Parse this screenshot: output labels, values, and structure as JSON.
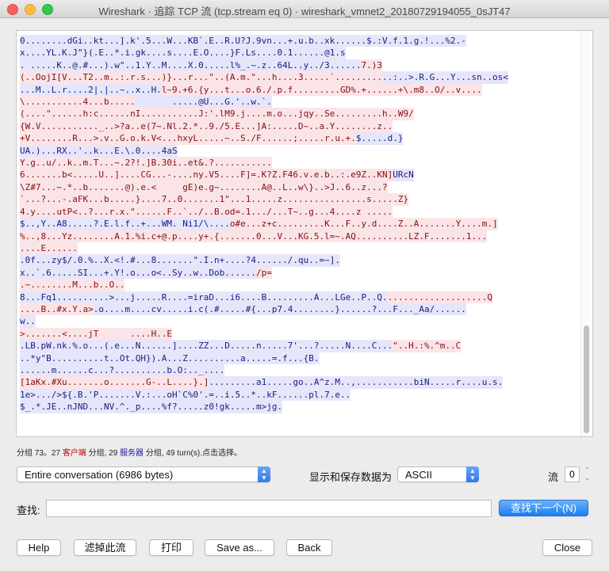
{
  "window": {
    "title": "Wireshark · 追踪 TCP 流 (tcp.stream eq 0) · wireshark_vmnet2_20180729194055_0sJT47"
  },
  "stream_lines": [
    [
      {
        "t": "0........dGi..kt...].k'.5...W...KB`.E..R.U?J.9vn...+.u.b..xk......$.:V.f.1.g.!...%2.-",
        "c": "srv"
      }
    ],
    [
      {
        "t": "x....YL.K.J\"}(.E..*.i.gk....s....E.O....}F.Ls....0.1......@1.s",
        "c": "srv"
      }
    ],
    [
      {
        "t": ". .....K..@.#...).w\"..1.Y..M....X.0.....l%_.~.z..64L..y../3......",
        "c": "srv"
      },
      {
        "t": "7.)3",
        "c": "cli"
      }
    ],
    [
      {
        "t": "(..OojI[V...T2..m..:.r.s...)}...r...\"..(A.m.\"...h....3.....`.........",
        "c": "cli"
      },
      {
        "t": "..:..>.R.G...Y...sn..os<",
        "c": "srv"
      }
    ],
    [
      {
        "t": "...M..L.r....2|.|..~..x..H.",
        "c": "srv"
      },
      {
        "t": "l~9.+6.{y...t...o.6./.p.f.........GD%.+......+\\.m8..O/..v....",
        "c": "cli"
      }
    ],
    [
      {
        "t": "\\...........4...b.....",
        "c": "cli"
      },
      {
        "t": "       .....@U...G.'..w.`.",
        "c": "srv"
      }
    ],
    [
      {
        "t": "(....\"......h:c......nI...........J:'.lM9.j....m.o...jqy..Se.........h..W9/",
        "c": "cli"
      }
    ],
    [
      {
        "t": "{W.V..........._..>?a..e(7~.Nl.2.*..9./5.E...]A:.....D~..a.Y........z..",
        "c": "cli"
      }
    ],
    [
      {
        "t": "+V........R...>.v..G.o.k.V<...hxyL.....~..S./F......;.....r.u.+.",
        "c": "cli"
      },
      {
        "t": "$.....d.}",
        "c": "srv"
      }
    ],
    [
      {
        "t": "UA.)...RX..'..k...E.\\.0....4aS",
        "c": "srv"
      }
    ],
    [
      {
        "t": "Y.g..u/..k..m.T...~.2?!.]B.30i..et&.?...........",
        "c": "cli"
      }
    ],
    [
      {
        "t": "6.......b<.....U..]....CG...-....ny.V5....F]=.K?Z.F46.v.e.b..:.e9Z..KN]",
        "c": "cli"
      },
      {
        "t": "URcN",
        "c": "srv"
      }
    ],
    [
      {
        "t": "\\Z#7...~.*..b.......@).e.<     gE)e.g~........A@..L..w\\}..>J..6..z...?",
        "c": "cli"
      }
    ],
    [
      {
        "t": "`...?...-.aFK...b.....}....7..0.......1\"...1.....z................s.....Z}",
        "c": "cli"
      }
    ],
    [
      {
        "t": "4.y....utP<..?...r.x.\"......F..`../..B.od=.1.../...T~..g...4....z .....",
        "c": "cli"
      }
    ],
    [
      {
        "t": "$..,Y..A8.....?.E.l.f..+...WM. Ni1/\\....",
        "c": "srv"
      },
      {
        "t": "o#e...z+c.........K...F..y.d....Z..A.......Y....m.]",
        "c": "cli"
      }
    ],
    [
      {
        "t": "%..,8...Yz........A.1.%i.c+@.p....y+.{.......0...V...KG.5.l=~.AQ..........LZ.F.......1...",
        "c": "cli"
      }
    ],
    [
      {
        "t": "....E......",
        "c": "cli"
      }
    ],
    [
      {
        "t": ".0f...zy$/.0.%..X.<!.#...8.......\".I.n+....?4....../.qu..=~].",
        "c": "srv"
      }
    ],
    [
      {
        "t": "x..`.6.....SI...+.Y!.o...o<..Sy..w..Dob......",
        "c": "srv"
      },
      {
        "t": "/p=",
        "c": "cli"
      }
    ],
    [
      {
        "t": ".~........M...b..O..",
        "c": "cli"
      }
    ],
    [
      {
        "t": "8...Fq1..........>...j.....R....=iraD...i6....B.........A...LGe..P..Q.",
        "c": "srv"
      },
      {
        "t": "...................Q",
        "c": "cli"
      }
    ],
    [
      {
        "t": "....B..#x.Y.a>",
        "c": "cli"
      },
      {
        "t": ".o....m....cv.....i.c(.#.....#{...p7.4........}......?...F..._Aa/......",
        "c": "srv"
      }
    ],
    [
      {
        "t": "w..",
        "c": "srv"
      }
    ],
    [
      {
        "t": ">.......<....jT      ....H..E",
        "c": "cli"
      }
    ],
    [
      {
        "t": ".LB.pW.nk.%.o...(.e...N......]....ZZ...D.....n.....7'...?.....N....C...",
        "c": "srv"
      },
      {
        "t": "\"..H.:%.^m..C",
        "c": "cli"
      }
    ],
    [
      {
        "t": "..*y\"B..........t..Ot.QH}).A...Z..........a.....=.f...{B.",
        "c": "srv"
      }
    ],
    [
      {
        "t": "......m......c...?..........b.O:.._....",
        "c": "srv"
      }
    ],
    [
      {
        "t": "[1aKx.#Xu.......o.......G-..L....}.]",
        "c": "cli"
      },
      {
        "t": ".........a1.....go..A^z.M..,...........biN.....r....u.s.",
        "c": "srv"
      }
    ],
    [
      {
        "t": "1e>.../>${.B.'P.......V.:...oH`C%0'.=..i.5..*..kF......pl.7.e..",
        "c": "srv"
      }
    ],
    [
      {
        "t": "$_.*.JE..nJND...NV.^._p....%f?.....z0!gk.....m>jg.",
        "c": "srv"
      }
    ]
  ],
  "status": {
    "pre": "分组 73。27 ",
    "client": "客户端",
    "mid": " 分组, 29 ",
    "server": "服务器",
    "post": " 分组, 49 turn(s).点击选择。"
  },
  "conversation_select": {
    "value": "Entire conversation (6986 bytes)"
  },
  "save_as_label": "显示和保存数据为",
  "format_select": {
    "value": "ASCII"
  },
  "stream_label": "流",
  "stream_number": "0",
  "find_label": "查找:",
  "find_input": {
    "value": ""
  },
  "find_next_button": "查找下一个(N)",
  "buttons": {
    "help": "Help",
    "filter_out": "滤掉此流",
    "print": "打印",
    "save_as": "Save as...",
    "back": "Back",
    "close": "Close"
  },
  "colors": {
    "client_bg": "#fbe4e7",
    "client_fg": "#7f1010",
    "server_bg": "#e6e6fb",
    "server_fg": "#1a1a7e",
    "accent": "#1a7ef1"
  }
}
